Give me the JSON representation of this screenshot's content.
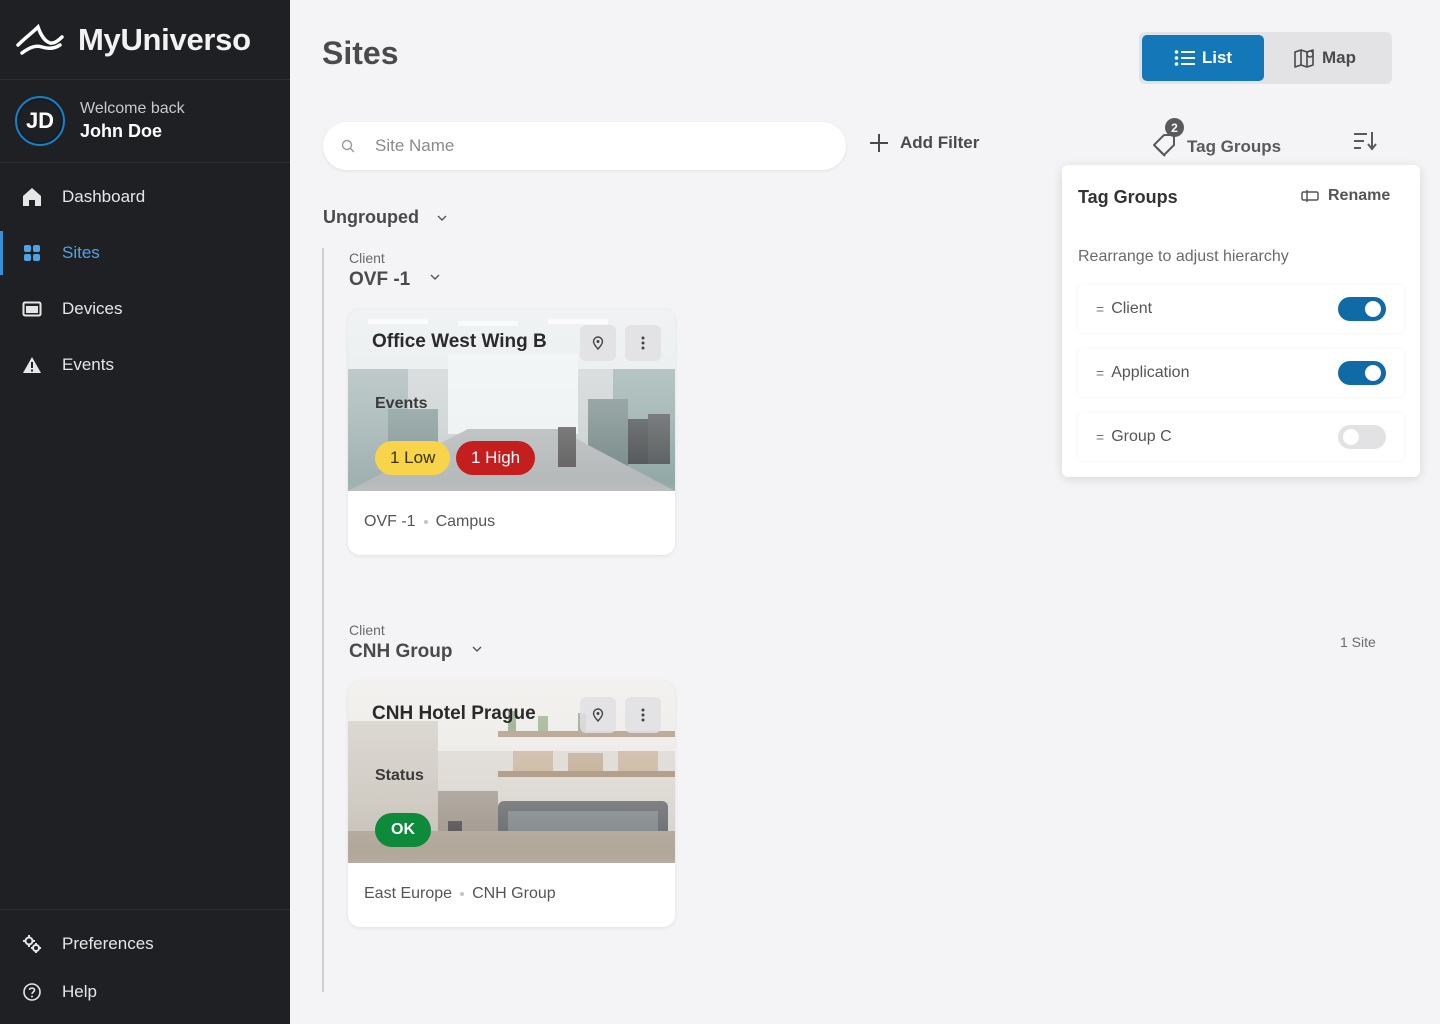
{
  "app": {
    "name": "MyUniverso"
  },
  "user": {
    "welcome": "Welcome back",
    "name": "John Doe",
    "initials": "JD"
  },
  "sidebar": {
    "items": [
      {
        "label": "Dashboard",
        "icon": "home-icon"
      },
      {
        "label": "Sites",
        "icon": "grid-icon",
        "active": true
      },
      {
        "label": "Devices",
        "icon": "device-icon"
      },
      {
        "label": "Events",
        "icon": "warning-icon"
      }
    ],
    "bottom": [
      {
        "label": "Preferences",
        "icon": "gears-icon"
      },
      {
        "label": "Help",
        "icon": "help-icon"
      }
    ]
  },
  "page": {
    "title": "Sites"
  },
  "view_toggle": {
    "list_label": "List",
    "map_label": "Map",
    "active": "List"
  },
  "toolbar": {
    "search_placeholder": "Site Name",
    "add_filter_label": "Add Filter",
    "tag_groups_label": "Tag Groups",
    "tag_groups_count": "2"
  },
  "groups": {
    "ungrouped_label": "Ungrouped",
    "clients": [
      {
        "label": "Client",
        "name": "OVF -1",
        "site": {
          "title": "Office West Wing B",
          "section": "Events",
          "badges": [
            "1 Low",
            "1 High"
          ],
          "tags": [
            "OVF -1",
            "Campus"
          ]
        }
      },
      {
        "label": "Client",
        "name": "CNH Group",
        "count": "1 Site",
        "site": {
          "title": "CNH Hotel Prague",
          "section": "Status",
          "badges": [
            "OK"
          ],
          "tags": [
            "East Europe",
            "CNH Group"
          ]
        }
      }
    ]
  },
  "tag_groups_panel": {
    "title": "Tag Groups",
    "rename_label": "Rename",
    "hint": "Rearrange to adjust hierarchy",
    "items": [
      {
        "label": "Client",
        "enabled": true
      },
      {
        "label": "Application",
        "enabled": true
      },
      {
        "label": "Group C",
        "enabled": false
      }
    ]
  },
  "colors": {
    "accent": "#1478b8",
    "sidebar_bg": "#1f2023",
    "low": "#f8d44a",
    "high": "#c41e1e",
    "ok": "#0d8a3a"
  }
}
